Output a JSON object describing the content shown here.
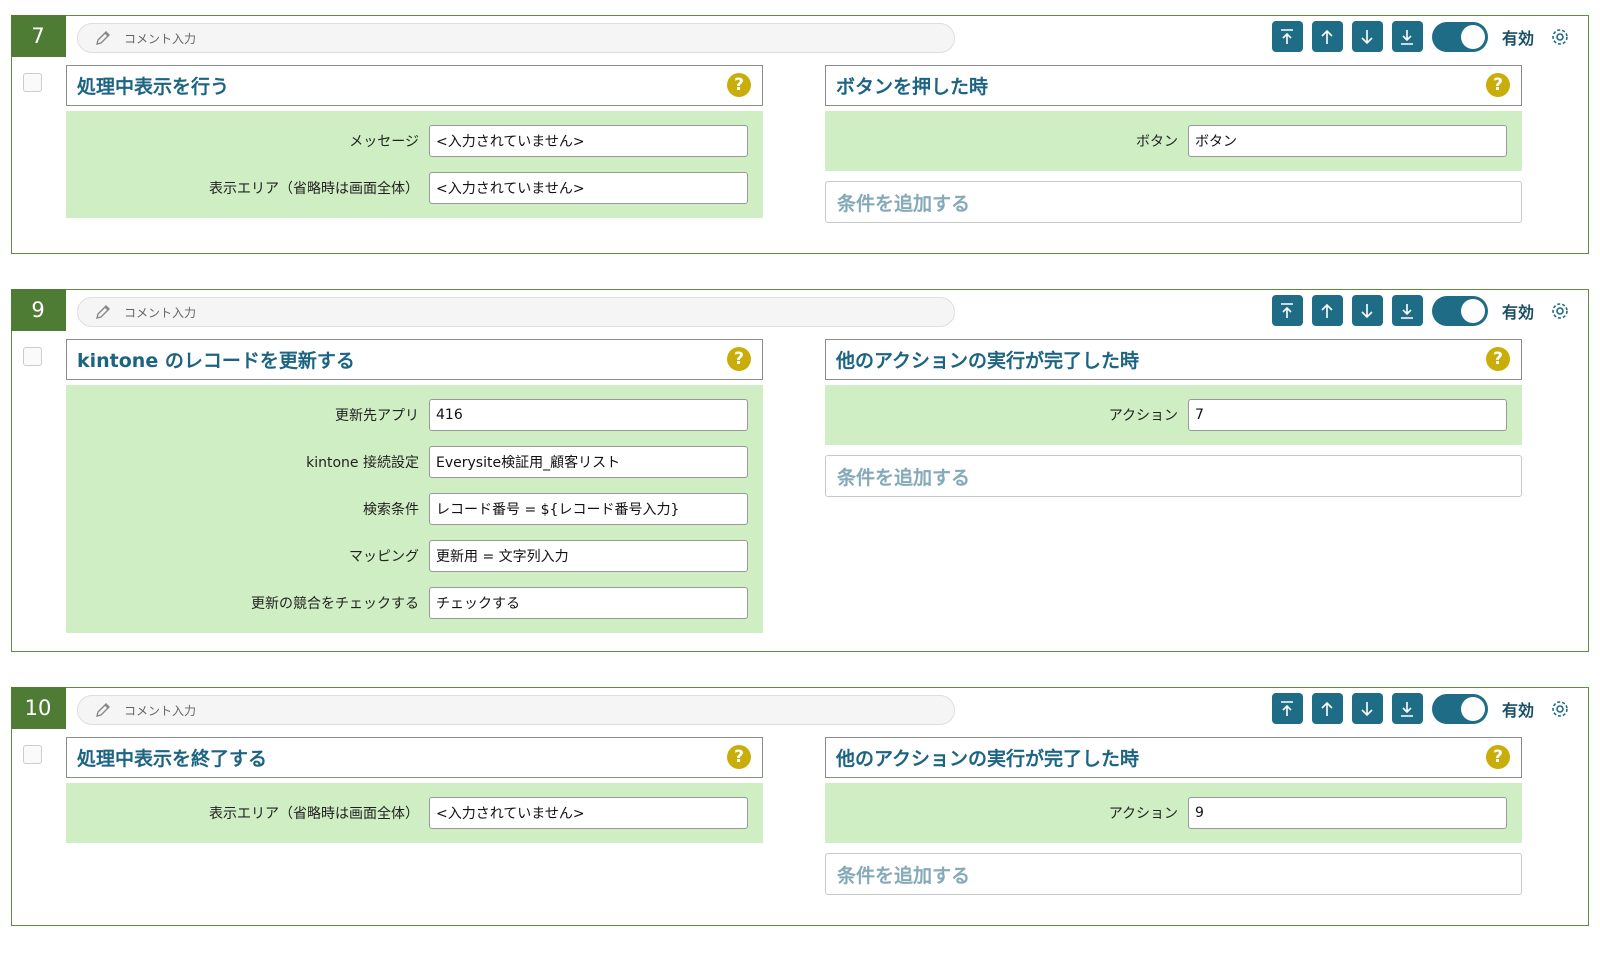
{
  "colors": {
    "accent": "#1e6c86",
    "block_border": "#5b8f3e",
    "field_bg": "#cfeec3",
    "help": "#c9ad0a"
  },
  "blocks": [
    {
      "number": "7",
      "comment_placeholder": "コメント入力",
      "enabled_label": "有効",
      "action": {
        "title": "処理中表示を行う",
        "fields": [
          {
            "label": "メッセージ",
            "value": "<入力されていません>"
          },
          {
            "label": "表示エリア（省略時は画面全体）",
            "value": "<入力されていません>"
          }
        ]
      },
      "trigger": {
        "title": "ボタンを押した時",
        "fields": [
          {
            "label": "ボタン",
            "value": "ボタン"
          }
        ],
        "add_condition": "条件を追加する"
      }
    },
    {
      "number": "9",
      "comment_placeholder": "コメント入力",
      "enabled_label": "有効",
      "action": {
        "title": "kintone のレコードを更新する",
        "fields": [
          {
            "label": "更新先アプリ",
            "value": "416"
          },
          {
            "label": "kintone 接続設定",
            "value": "Everysite検証用_顧客リスト"
          },
          {
            "label": "検索条件",
            "value": "レコード番号 = ${レコード番号入力}"
          },
          {
            "label": "マッピング",
            "value": "更新用 =  文字列入力"
          },
          {
            "label": "更新の競合をチェックする",
            "value": "チェックする"
          }
        ]
      },
      "trigger": {
        "title": "他のアクションの実行が完了した時",
        "fields": [
          {
            "label": "アクション",
            "value": "7"
          }
        ],
        "add_condition": "条件を追加する"
      }
    },
    {
      "number": "10",
      "comment_placeholder": "コメント入力",
      "enabled_label": "有効",
      "action": {
        "title": "処理中表示を終了する",
        "fields": [
          {
            "label": "表示エリア（省略時は画面全体）",
            "value": "<入力されていません>"
          }
        ]
      },
      "trigger": {
        "title": "他のアクションの実行が完了した時",
        "fields": [
          {
            "label": "アクション",
            "value": "9"
          }
        ],
        "add_condition": "条件を追加する"
      }
    }
  ],
  "icons": {
    "help": "?",
    "move_top": "move-to-top-icon",
    "move_up": "move-up-icon",
    "move_down": "move-down-icon",
    "move_bottom": "move-to-bottom-icon",
    "gear": "gear-icon",
    "pencil": "pencil-icon"
  }
}
